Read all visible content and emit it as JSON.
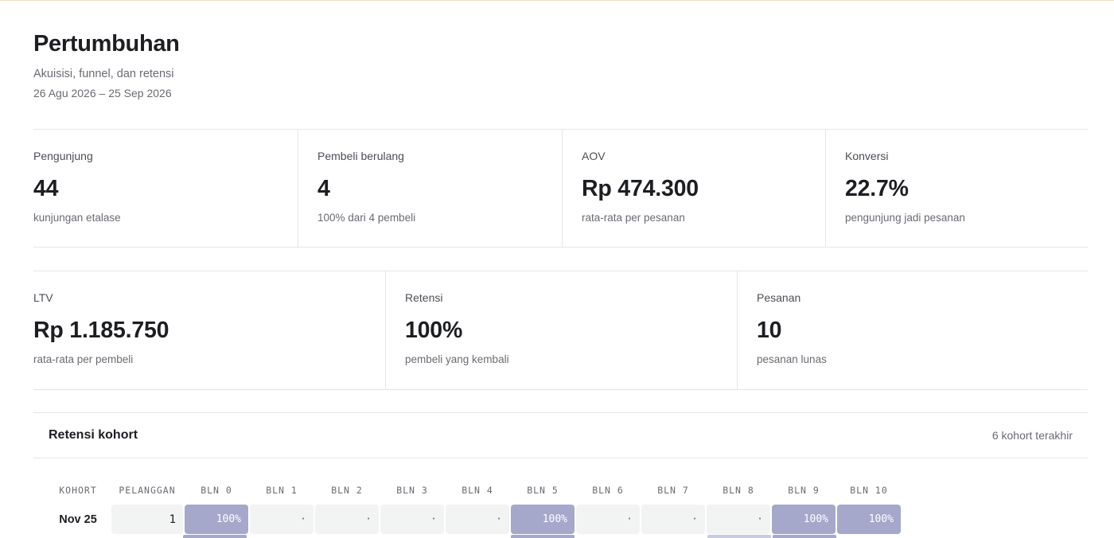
{
  "header": {
    "title": "Pertumbuhan",
    "subtitle": "Akuisisi, funnel, dan retensi",
    "date_range": "26 Agu 2026 – 25 Sep 2026"
  },
  "stats_row1": [
    {
      "label": "Pengunjung",
      "value": "44",
      "sub": "kunjungan etalase"
    },
    {
      "label": "Pembeli berulang",
      "value": "4",
      "sub": "100% dari 4 pembeli"
    },
    {
      "label": "AOV",
      "value": "Rp 474.300",
      "sub": "rata-rata per pesanan"
    },
    {
      "label": "Konversi",
      "value": "22.7%",
      "sub": "pengunjung jadi pesanan"
    }
  ],
  "stats_row2": [
    {
      "label": "LTV",
      "value": "Rp 1.185.750",
      "sub": "rata-rata per pembeli"
    },
    {
      "label": "Retensi",
      "value": "100%",
      "sub": "pembeli yang kembali"
    },
    {
      "label": "Pesanan",
      "value": "10",
      "sub": "pesanan lunas"
    }
  ],
  "cohort": {
    "title": "Retensi kohort",
    "note": "6 kohort terakhir",
    "columns": [
      "KOHORT",
      "PELANGGAN",
      "BLN 0",
      "BLN 1",
      "BLN 2",
      "BLN 3",
      "BLN 4",
      "BLN 5",
      "BLN 6",
      "BLN 7",
      "BLN 8",
      "BLN 9",
      "BLN 10"
    ],
    "rows": [
      {
        "label": "Nov 25",
        "customers": "1",
        "cells": [
          "100%",
          "·",
          "·",
          "·",
          "·",
          "100%",
          "·",
          "·",
          "·",
          "100%",
          "100%"
        ]
      }
    ]
  },
  "colors": {
    "accent_cell": "#a5a8cb",
    "empty_cell": "#f2f3f3",
    "border": "#e5e5e7"
  }
}
